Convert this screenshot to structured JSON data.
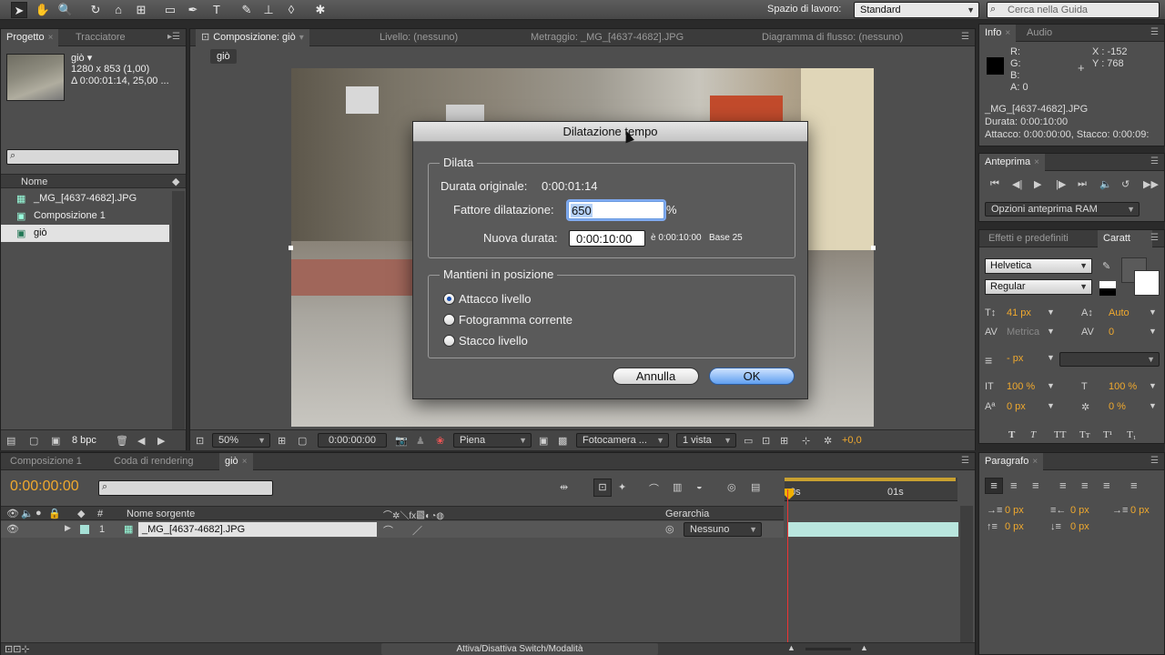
{
  "toolbar": {
    "workspace_label": "Spazio di lavoro:",
    "workspace_value": "Standard",
    "help_placeholder": "Cerca nella Guida"
  },
  "project": {
    "tab_project": "Progetto",
    "tab_tracker": "Tracciatore",
    "item_name": "giò ▾",
    "item_dims": "1280 x 853 (1,00)",
    "item_dur": "Δ 0:00:01:14, 25,00 ...",
    "col_name": "Nome",
    "files": [
      "_MG_[4637-4682].JPG",
      "Composizione 1",
      "giò"
    ],
    "bpc": "8 bpc"
  },
  "comp": {
    "tab_comp": "Composizione: giò",
    "tab_layer": "Livello: (nessuno)",
    "tab_footage": "Metraggio: _MG_[4637-4682].JPG",
    "tab_flow": "Diagramma di flusso: (nessuno)",
    "crumb": "giò",
    "zoom": "50%",
    "time": "0:00:00:00",
    "resolution": "Piena",
    "camera": "Fotocamera ...",
    "views": "1 vista",
    "exposure": "+0,0"
  },
  "dialog": {
    "title": "Dilatazione tempo",
    "group1": "Dilata",
    "orig_label": "Durata originale:",
    "orig_value": "0:00:01:14",
    "factor_label": "Fattore dilatazione:",
    "factor_value": "650",
    "percent": "%",
    "new_label": "Nuova durata:",
    "new_value": "0:00:10:00",
    "new_note": "è 0:00:10:00",
    "base_note": "Base 25",
    "group2": "Mantieni in posizione",
    "opt1": "Attacco livello",
    "opt2": "Fotogramma corrente",
    "opt3": "Stacco livello",
    "cancel": "Annulla",
    "ok": "OK"
  },
  "info": {
    "tab_info": "Info",
    "tab_audio": "Audio",
    "r": "R:",
    "g": "G:",
    "b": "B:",
    "a": "A:  0",
    "x": "X : -152",
    "y": "Y : 768",
    "file": "_MG_[4637-4682].JPG",
    "dur": "Durata: 0:00:10:00",
    "inout": "Attacco: 0:00:00:00, Stacco: 0:00:09:"
  },
  "preview": {
    "tab": "Anteprima",
    "ram": "Opzioni anteprima RAM"
  },
  "char": {
    "tab_effects": "Effetti e predefiniti",
    "tab_char": "Caratt",
    "font": "Helvetica",
    "style": "Regular",
    "size": "41 px",
    "leading": "Auto",
    "kerning": "Metrica",
    "tracking": "0",
    "stroke": "- px",
    "vscale": "100 %",
    "hscale": "100 %",
    "baseline": "0 px",
    "tsume": "0 %",
    "styles": [
      "T",
      "T",
      "TT",
      "Tт",
      "T¹",
      "T₁"
    ]
  },
  "paragraph": {
    "tab": "Paragrafo",
    "indent1": "0 px",
    "indent2": "0 px",
    "indent3": "0 px",
    "space1": "0 px",
    "space2": "0 px"
  },
  "timeline": {
    "tab1": "Composizione 1",
    "tab2": "Coda di rendering",
    "tab3": "giò",
    "timecode": "0:00:00:00",
    "col_hash": "#",
    "col_source": "Nome sorgente",
    "col_parent": "Gerarchia",
    "layer_num": "1",
    "layer_name": "_MG_[4637-4682].JPG",
    "parent_value": "Nessuno",
    "ruler_0": "0s",
    "ruler_1": "01s",
    "toggle": "Attiva/Disattiva Switch/Modalità"
  }
}
